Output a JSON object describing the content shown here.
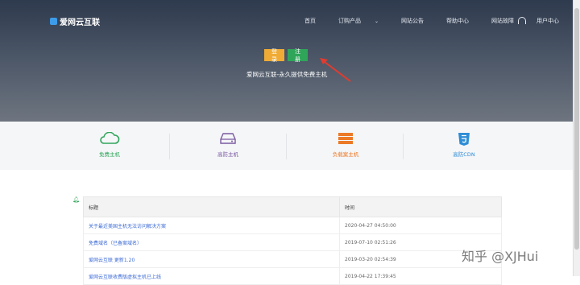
{
  "header": {
    "notice": "",
    "logo": "爱网云互联",
    "nav": [
      {
        "label": "首页",
        "caret": false
      },
      {
        "label": "订购产品",
        "caret": true
      },
      {
        "label": "网站公告",
        "caret": false
      },
      {
        "label": "帮助中心",
        "caret": false
      },
      {
        "label": "网站故障",
        "caret": false
      },
      {
        "label": "用户中心",
        "caret": true
      }
    ]
  },
  "hero": {
    "login_label": "登录",
    "register_label": "注册",
    "subtitle": "爱网云互联-永久提供免费主机"
  },
  "features": [
    {
      "label": "免费主机",
      "color": "#2fa55a",
      "icon": "cloud-icon"
    },
    {
      "label": "高防主机",
      "color": "#7a5aa0",
      "icon": "server-icon"
    },
    {
      "label": "负载案主机",
      "color": "#ec7a27",
      "icon": "stack-icon"
    },
    {
      "label": "高防CDN",
      "color": "#2f8dd6",
      "icon": "html5-icon"
    }
  ],
  "table": {
    "header_title": "标题",
    "header_time": "时间",
    "rows": [
      {
        "title": "关于最近美国主机无法访问解决方案",
        "time": "2020-04-27 04:50:00"
      },
      {
        "title": "免费域名（已备案域名）",
        "time": "2019-07-10 02:51:26"
      },
      {
        "title": "爱网云互联 更新1.20",
        "time": "2019-03-20 02:54:39"
      },
      {
        "title": "爱网云互联收费版虚拟主机已上线",
        "time": "2019-04-22 17:39:45"
      }
    ]
  },
  "watermark": "知乎 @XJHui"
}
